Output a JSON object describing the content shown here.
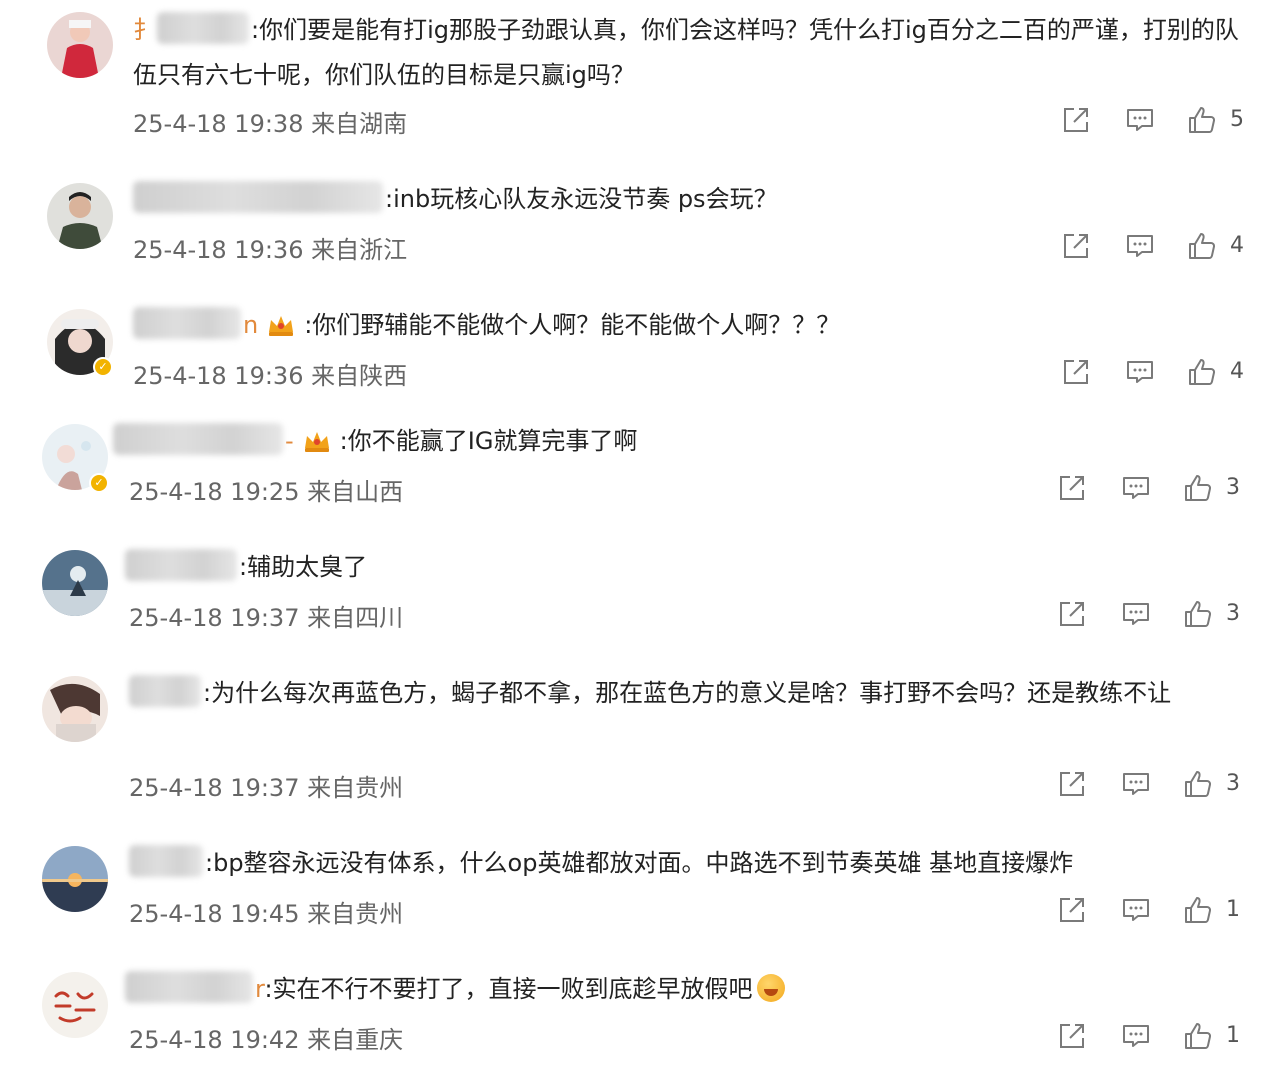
{
  "comments": [
    {
      "text": ":你们要是能有打ig那股子劲跟认真，你们会这样吗？凭什么打ig百分之二百的严谨，打别的队伍只有六七十呢，你们队伍的目标是只赢ig吗？",
      "name_visible": "扌",
      "name_tail": "",
      "time": "25-4-18 19:38",
      "location": "来自湖南",
      "likes": "5",
      "avatar_colors": [
        "#e9d5d2",
        "#c92a3a"
      ]
    },
    {
      "text": ":inb玩核心队友永远没节奏 ps会玩？",
      "name_visible": "",
      "name_tail": "",
      "time": "25-4-18 19:36",
      "location": "来自浙江",
      "likes": "4",
      "avatar_colors": [
        "#dcdcdc",
        "#3e4a3a"
      ]
    },
    {
      "text": ":你们野辅能不能做个人啊？能不能做个人啊？？？",
      "name_visible": "",
      "name_tail": "n",
      "time": "25-4-18 19:36",
      "location": "来自陕西",
      "likes": "4",
      "avatar_colors": [
        "#2a2a2a",
        "#e8d6cf"
      ]
    },
    {
      "text": ":你不能赢了IG就算完事了啊",
      "name_visible": "",
      "name_tail": "-",
      "time": "25-4-18 19:25",
      "location": "来自山西",
      "likes": "3",
      "avatar_colors": [
        "#e8eef2",
        "#c7a6a0"
      ]
    },
    {
      "text": ":辅助太臭了",
      "name_visible": "",
      "name_tail": "",
      "time": "25-4-18 19:37",
      "location": "来自四川",
      "likes": "3",
      "avatar_colors": [
        "#4b6a86",
        "#cfd8e0"
      ]
    },
    {
      "text": ":为什么每次再蓝色方，蝎子都不拿，那在蓝色方的意义是啥？事打野不会吗？还是教练不让",
      "name_visible": "",
      "name_tail": "",
      "time": "25-4-18 19:37",
      "location": "来自贵州",
      "likes": "3",
      "avatar_colors": [
        "#efe3dc",
        "#5a3f3a"
      ]
    },
    {
      "text": ":bp整容永远没有体系，什么op英雄都放对面。中路选不到节奏英雄 基地直接爆炸",
      "name_visible": "",
      "name_tail": "",
      "time": "25-4-18 19:45",
      "location": "来自贵州",
      "likes": "1",
      "avatar_colors": [
        "#8aa4c4",
        "#f0b46a"
      ]
    },
    {
      "text": ":实在不行不要打了，直接一败到底趁早放假吧",
      "name_visible": "",
      "name_tail": "r",
      "time": "25-4-18 19:42",
      "location": "来自重庆",
      "likes": "1",
      "avatar_colors": [
        "#f4f1ec",
        "#c23b2a"
      ]
    }
  ],
  "icons": {
    "share": "share-icon",
    "comment": "comment-icon",
    "like": "thumbs-up-icon",
    "crown": "crown-badge-icon",
    "verified": "verified-badge-icon",
    "emoji": "grinning-sweat-emoji-icon"
  },
  "colors": {
    "text": "#222222",
    "meta": "#666666",
    "icon": "#7a7a7a",
    "badge": "#f2b300",
    "name_accent": "#e2893b"
  }
}
